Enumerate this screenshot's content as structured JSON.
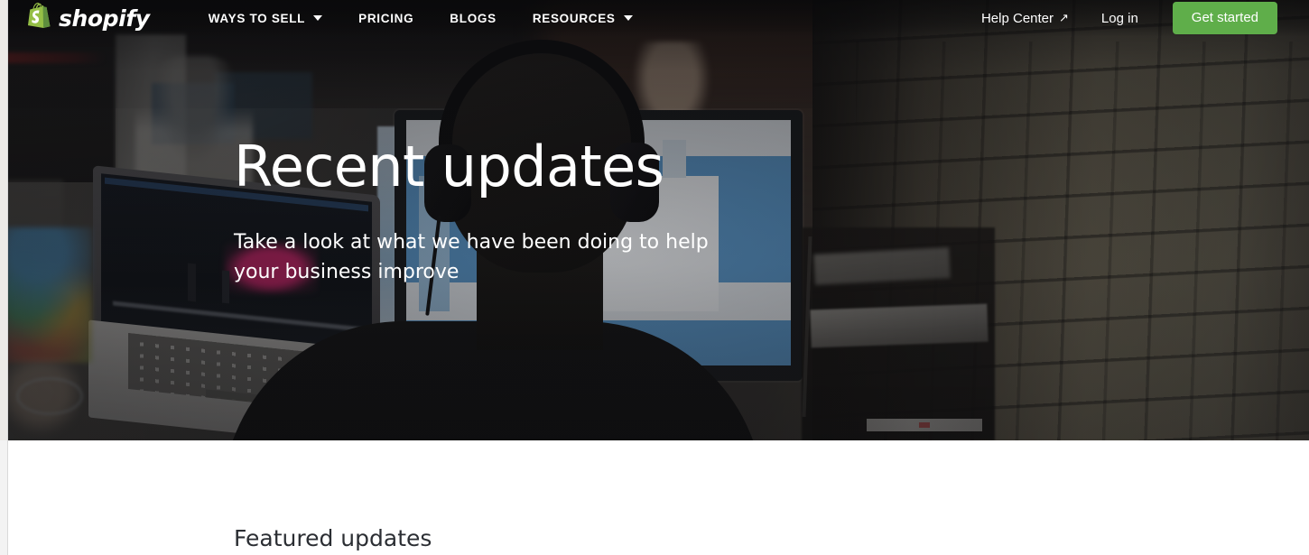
{
  "brand": {
    "name": "shopify",
    "logo_icon": "shopify-bag-icon",
    "logo_letter": "s",
    "accent_green": "#5fae4a",
    "logo_green_light": "#95bf46",
    "logo_green_dark": "#5e8e3e"
  },
  "navbar": {
    "items": [
      {
        "label": "WAYS TO SELL",
        "has_caret": true,
        "caret_icon": "chevron-down-icon"
      },
      {
        "label": "PRICING",
        "has_caret": false,
        "caret_icon": ""
      },
      {
        "label": "BLOGS",
        "has_caret": false,
        "caret_icon": ""
      },
      {
        "label": "RESOURCES",
        "has_caret": true,
        "caret_icon": "chevron-down-icon"
      }
    ],
    "help_center": {
      "label": "Help Center",
      "icon": "external-link-arrow-icon",
      "glyph": "↗"
    },
    "login": {
      "label": "Log in"
    },
    "cta": {
      "label": "Get started",
      "color": "#5fae4a"
    }
  },
  "hero": {
    "title": "Recent updates",
    "subtitle": "Take a look at what we have been doing to help your business improve",
    "background_image_alt": "Darkened photo of an office: a person wearing headphones at a desk facing monitors, a MacBook in the foreground, and a painted brick wall on the right",
    "overlay_color": "#0e0e10"
  },
  "content": {
    "section_title": "Featured updates",
    "section_title_color": "#2b2e33",
    "background": "#ffffff"
  }
}
